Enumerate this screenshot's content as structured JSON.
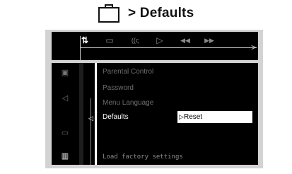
{
  "header": {
    "icon": "briefcase-icon",
    "separator": ">",
    "title": "Defaults"
  },
  "toolbar": {
    "items": [
      {
        "icon": "preferences-icon",
        "glyph": "⇅"
      },
      {
        "icon": "subtitle-icon",
        "glyph": "▭"
      },
      {
        "icon": "audio-wave-icon",
        "glyph": "((ς"
      },
      {
        "icon": "play-icon",
        "glyph": "▷"
      },
      {
        "icon": "rewind-icon",
        "glyph": "◀◀"
      },
      {
        "icon": "fast-forward-icon",
        "glyph": "▶▶"
      }
    ],
    "arrow": ">"
  },
  "side_icons": [
    {
      "icon": "picture-icon",
      "glyph": "▣"
    },
    {
      "icon": "speaker-icon",
      "glyph": "◁"
    },
    {
      "icon": "speech-bubble-icon",
      "glyph": "▭"
    },
    {
      "icon": "briefcase-icon",
      "glyph": "▥"
    }
  ],
  "menu": {
    "items": [
      "Parental Control",
      "Password",
      "Menu Language",
      "Defaults"
    ],
    "selected_index": 3,
    "option_value": "Reset"
  },
  "status": "Load factory settings",
  "colors": {
    "background": "#000000",
    "frame": "#d3d3d3",
    "highlight": "#ffffff",
    "inactive_text": "#6e6e6e"
  }
}
